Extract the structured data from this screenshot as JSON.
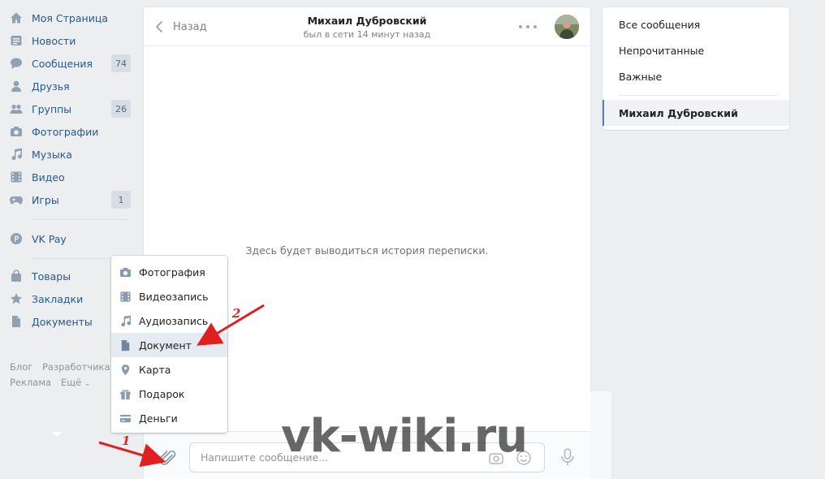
{
  "sidebar": {
    "items": [
      {
        "label": "Моя Страница",
        "icon": "home-icon"
      },
      {
        "label": "Новости",
        "icon": "news-icon"
      },
      {
        "label": "Сообщения",
        "icon": "messages-icon",
        "badge": "74"
      },
      {
        "label": "Друзья",
        "icon": "user-icon"
      },
      {
        "label": "Группы",
        "icon": "groups-icon",
        "badge": "26"
      },
      {
        "label": "Фотографии",
        "icon": "camera-icon"
      },
      {
        "label": "Музыка",
        "icon": "music-icon"
      },
      {
        "label": "Видео",
        "icon": "video-icon"
      },
      {
        "label": "Игры",
        "icon": "gamepad-icon",
        "badge": "1"
      },
      {
        "label": "VK Pay",
        "icon": "vkpay-icon"
      },
      {
        "label": "Товары",
        "icon": "bag-icon"
      },
      {
        "label": "Закладки",
        "icon": "star-icon"
      },
      {
        "label": "Документы",
        "icon": "document-icon"
      }
    ],
    "footer": {
      "blog": "Блог",
      "developers": "Разработчикам",
      "ads": "Реклама",
      "more": "Ещё"
    }
  },
  "chat": {
    "back_label": "Назад",
    "peer_name": "Михаил Дубровский",
    "peer_status": "был в сети 14 минут назад",
    "empty_text": "Здесь будет выводиться история переписки.",
    "input_placeholder": "Напишите сообщение..."
  },
  "attach_menu": {
    "items": [
      {
        "label": "Фотография",
        "icon": "camera-icon"
      },
      {
        "label": "Видеозапись",
        "icon": "film-icon"
      },
      {
        "label": "Аудиозапись",
        "icon": "music-note-icon"
      },
      {
        "label": "Документ",
        "icon": "document-icon",
        "active": true
      },
      {
        "label": "Карта",
        "icon": "map-pin-icon"
      },
      {
        "label": "Подарок",
        "icon": "gift-icon"
      },
      {
        "label": "Деньги",
        "icon": "money-card-icon"
      }
    ]
  },
  "filters": {
    "all": "Все сообщения",
    "unread": "Непрочитанные",
    "important": "Важные",
    "active_chat": "Михаил Дубровский"
  },
  "annotations": {
    "step1": "1",
    "step2": "2",
    "watermark": "vk-wiki.ru"
  },
  "colors": {
    "accent": "#5181b8",
    "link": "#2a5885",
    "arrow": "#e02020",
    "background": "#edeef0"
  }
}
